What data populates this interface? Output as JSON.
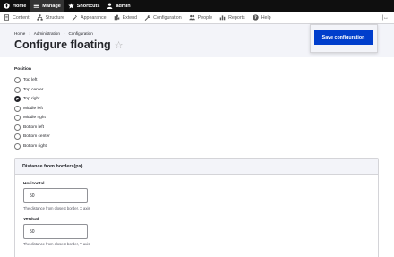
{
  "toolbar": {
    "items": [
      {
        "label": "Home",
        "icon": "drupal-drop-icon",
        "active": false
      },
      {
        "label": "Manage",
        "icon": "hamburger-menu-icon",
        "active": true
      },
      {
        "label": "Shortcuts",
        "icon": "star-icon",
        "active": false
      },
      {
        "label": "admin",
        "icon": "user-icon",
        "active": false
      }
    ]
  },
  "menubar": {
    "items": [
      {
        "label": "Content",
        "icon": "content-icon"
      },
      {
        "label": "Structure",
        "icon": "structure-icon"
      },
      {
        "label": "Appearance",
        "icon": "appearance-icon"
      },
      {
        "label": "Extend",
        "icon": "extend-icon"
      },
      {
        "label": "Configuration",
        "icon": "wrench-icon"
      },
      {
        "label": "People",
        "icon": "people-icon"
      },
      {
        "label": "Reports",
        "icon": "reports-icon"
      },
      {
        "label": "Help",
        "icon": "help-icon"
      }
    ],
    "orientation_toggle": "|↔"
  },
  "breadcrumb": {
    "home": "Home",
    "administration": "Administration",
    "configuration": "Configuration",
    "separator": "›"
  },
  "page": {
    "title": "Configure floating",
    "favorite_icon": "☆"
  },
  "save_button": {
    "label": "Save configuration"
  },
  "position": {
    "label": "Position",
    "options": [
      "Top left",
      "Top center",
      "Top right",
      "Middle left",
      "Middle right",
      "Bottom left",
      "Bottom center",
      "Bottom right"
    ],
    "selected": "Top right"
  },
  "distance": {
    "legend": "Distance from borders(px)",
    "horizontal": {
      "label": "Horizontal",
      "value": "50",
      "description": "The distance from closest border, X axis"
    },
    "vertical": {
      "label": "Vertical",
      "value": "50",
      "description": "The distance from closest border, Y axis"
    }
  },
  "colors": {
    "toolbar_bg": "#0f0f0f",
    "primary": "#003ecc",
    "header_bg": "#f3f4f9"
  }
}
